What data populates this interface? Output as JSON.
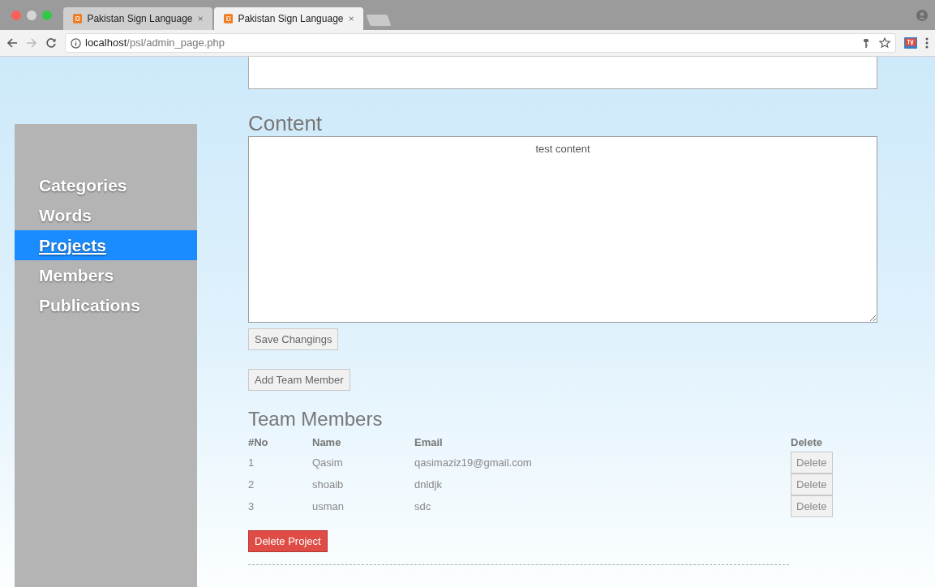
{
  "browser": {
    "tabs": [
      {
        "title": "Pakistan Sign Language",
        "selected": false
      },
      {
        "title": "Pakistan Sign Language",
        "selected": true
      }
    ],
    "address": {
      "host": "localhost",
      "path": "/psl/admin_page.php"
    }
  },
  "sidebar": {
    "items": [
      {
        "label": "Categories",
        "selected": false
      },
      {
        "label": "Words",
        "selected": false
      },
      {
        "label": "Projects",
        "selected": true
      },
      {
        "label": "Members",
        "selected": false
      },
      {
        "label": "Publications",
        "selected": false
      }
    ]
  },
  "content": {
    "heading": "Content",
    "value": "test content",
    "save_button": "Save Changings"
  },
  "add_member_button": "Add Team Member",
  "team": {
    "heading": "Team Members",
    "columns": [
      "#No",
      "Name",
      "Email",
      "Delete"
    ],
    "rows": [
      {
        "no": "1",
        "name": "Qasim",
        "email": "qasimaziz19@gmail.com",
        "action": "Delete"
      },
      {
        "no": "2",
        "name": "shoaib",
        "email": "dnldjk",
        "action": "Delete"
      },
      {
        "no": "3",
        "name": "usman",
        "email": "sdc",
        "action": "Delete"
      }
    ]
  },
  "delete_project_button": "Delete Project"
}
